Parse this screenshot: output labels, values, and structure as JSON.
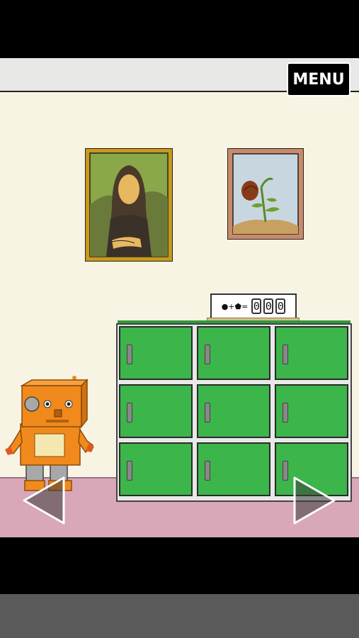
{
  "menu": {
    "label": "MENU"
  },
  "lock": {
    "hint_text": "●+⬟=",
    "digits": [
      "0",
      "0",
      "0"
    ]
  },
  "lockers": [
    {
      "row": 1,
      "col": 1
    },
    {
      "row": 1,
      "col": 2
    },
    {
      "row": 1,
      "col": 3
    },
    {
      "row": 2,
      "col": 1
    },
    {
      "row": 2,
      "col": 2
    },
    {
      "row": 2,
      "col": 3
    },
    {
      "row": 3,
      "col": 1
    },
    {
      "row": 3,
      "col": 2
    },
    {
      "row": 3,
      "col": 3
    }
  ],
  "colors": {
    "locker_green": "#3cb54a",
    "wall": "#f8f4e4",
    "floor": "#d8a8b8",
    "robot_orange": "#f08a1c",
    "frame_gold": "#c99a1a",
    "frame_copper": "#c98a6a"
  },
  "icons": {
    "left_nav": "triangle-left-icon",
    "right_nav": "triangle-right-icon"
  }
}
